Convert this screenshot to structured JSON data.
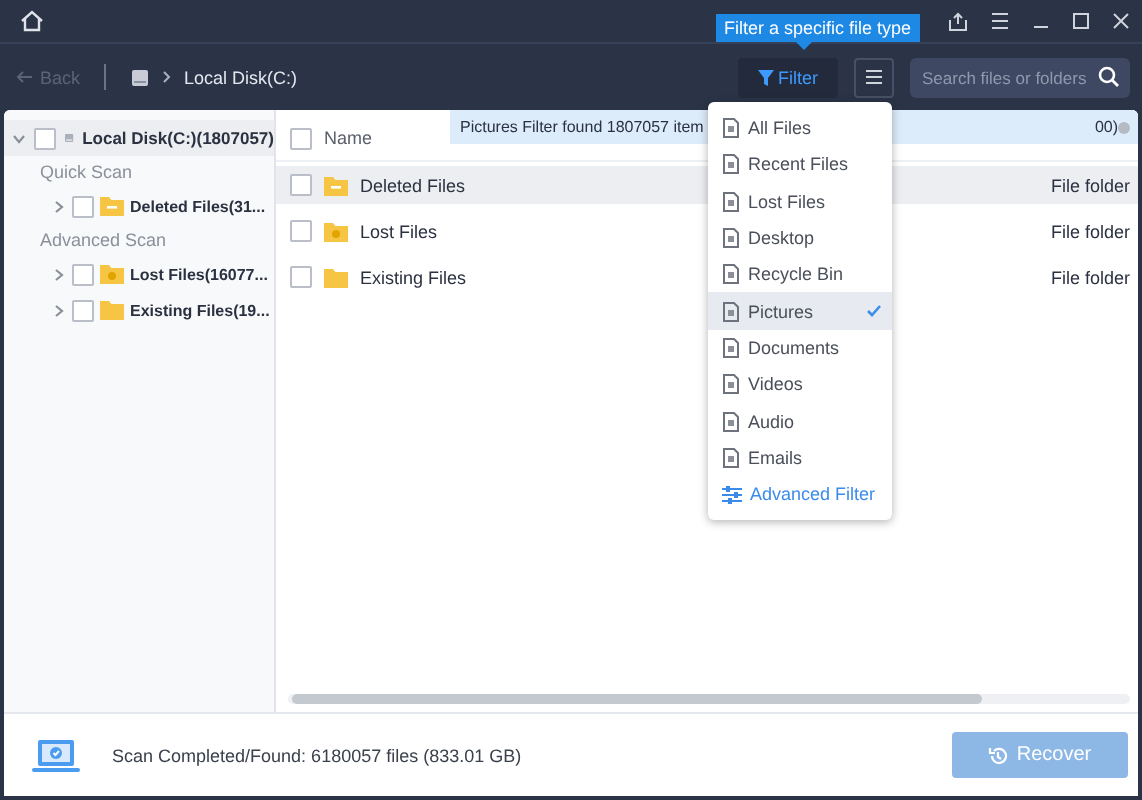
{
  "title_bar": {
    "tooltip": "Filter a specific file type"
  },
  "toolbar": {
    "back": {
      "label": "Back",
      "disabled": true
    },
    "breadcrumb": "Local Disk(C:)",
    "filter_button": "Filter",
    "search": {
      "placeholder": "Search files or folders"
    }
  },
  "tree": {
    "root": {
      "label": "Local Disk(C:)(1807057)",
      "checked": false,
      "expanded": true,
      "selected": true
    },
    "sections": [
      {
        "heading": "Quick Scan",
        "items": [
          {
            "label": "Deleted Files(31...",
            "kind": "deleted",
            "checked": false,
            "expanded": false
          }
        ]
      },
      {
        "heading": "Advanced Scan",
        "items": [
          {
            "label": "Lost Files(16077...",
            "kind": "lost",
            "checked": false,
            "expanded": false
          },
          {
            "label": "Existing Files(19...",
            "kind": "existing",
            "checked": false,
            "expanded": false
          }
        ]
      }
    ]
  },
  "file_list": {
    "header": {
      "label": "Name",
      "checked": false
    },
    "notice": {
      "text_start": "Pictures Filter found 1807057 item",
      "text_end": "00)"
    },
    "rows": [
      {
        "name": "Deleted Files",
        "kind": "deleted",
        "type": "File folder",
        "checked": false,
        "selected": true
      },
      {
        "name": "Lost Files",
        "kind": "lost",
        "type": "File folder",
        "checked": false,
        "selected": false
      },
      {
        "name": "Existing Files",
        "kind": "existing",
        "type": "File folder",
        "checked": false,
        "selected": false
      }
    ]
  },
  "filter_menu": {
    "items": [
      {
        "label": "All Files",
        "selected": false
      },
      {
        "label": "Recent Files",
        "selected": false
      },
      {
        "label": "Lost Files",
        "selected": false
      },
      {
        "label": "Desktop",
        "selected": false
      },
      {
        "label": "Recycle Bin",
        "selected": false
      },
      {
        "label": "Pictures",
        "selected": true
      },
      {
        "label": "Documents",
        "selected": false
      },
      {
        "label": "Videos",
        "selected": false
      },
      {
        "label": "Audio",
        "selected": false
      },
      {
        "label": "Emails",
        "selected": false
      }
    ],
    "advanced": "Advanced Filter"
  },
  "status_bar": {
    "text": "Scan Completed/Found: 6180057 files (833.01 GB)",
    "recover": {
      "label": "Recover",
      "disabled": true
    }
  }
}
